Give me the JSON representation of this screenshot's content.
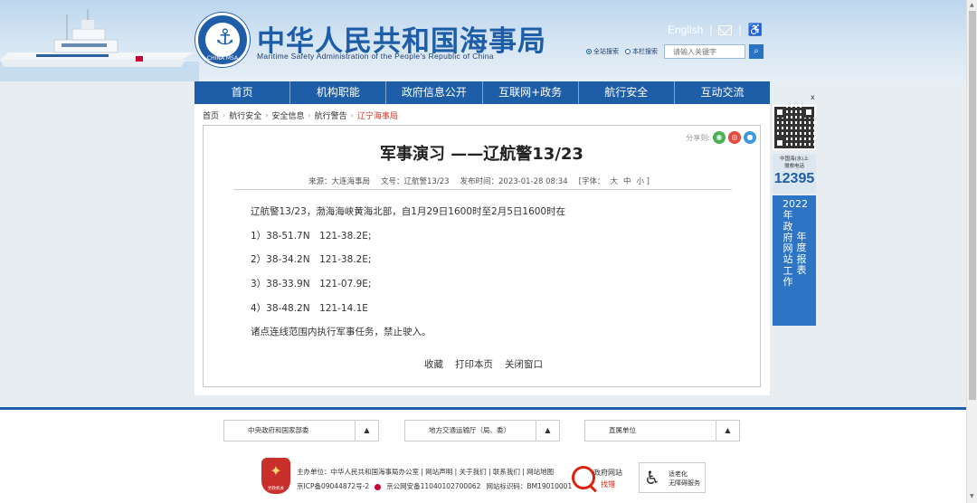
{
  "header": {
    "title": "中华人民共和国海事局",
    "subtitle": "Maritime Safety Administration of the People's Republic of China",
    "logo_text": "CHINA MSA",
    "english_link": "English",
    "search": {
      "options": [
        "全站搜索",
        "本栏搜索"
      ],
      "placeholder": "请输入关键字"
    }
  },
  "nav": {
    "items": [
      "首页",
      "机构职能",
      "政府信息公开",
      "互联网+政务",
      "航行安全",
      "互动交流"
    ]
  },
  "breadcrumb": [
    "首页",
    "航行安全",
    "安全信息",
    "航行警告",
    "辽宁海事局"
  ],
  "article": {
    "share_label": "分享到:",
    "title": "军事演习 ——辽航警13/23",
    "meta": {
      "source": "来源：大连海事局",
      "doc_no": "文号：辽航警13/23",
      "time": "发布时间：2023-01-28 08:34",
      "font_label": "[字体：",
      "font_big": "大",
      "font_mid": "中",
      "font_small": "小 ]"
    },
    "paragraphs": [
      "辽航警13/23，渤海海峡黄海北部，自1月29日1600时至2月5日1600时在",
      "1）38-51.7N　121-38.2E;",
      "2）38-34.2N　121-38.2E;",
      "3）38-33.9N　121-07.9E;",
      "4）38-48.2N　121-14.1E",
      "诸点连线范围内执行军事任务，禁止驶入。"
    ],
    "actions": [
      "收藏",
      "打印本页",
      "关闭窗口"
    ]
  },
  "sidebar": {
    "close": "x",
    "hotline_label1": "中国海(水)上",
    "hotline_label2": "搜救电话",
    "hotline_number": "12395",
    "report_col1": "2022年政府网站工作",
    "report_col2": "年度报表"
  },
  "footer": {
    "dropdowns": [
      "中央政府和国家部委",
      "地方交通运输厅（局、委）",
      "直属单位"
    ],
    "party_label": "党政机关",
    "host_line": "主办单位：中华人民共和国海事局办公室 | 网站声明 | 关于我们 | 联系我们 | 网站地图",
    "icp": "京ICP备09044872号-2",
    "police": "京公网安备11040102700062",
    "site_code": "网站标识码：BM19010001",
    "gov_find_1": "政府网站",
    "gov_find_2": "找错",
    "elder_1": "适老化",
    "elder_2": "无障碍服务"
  }
}
